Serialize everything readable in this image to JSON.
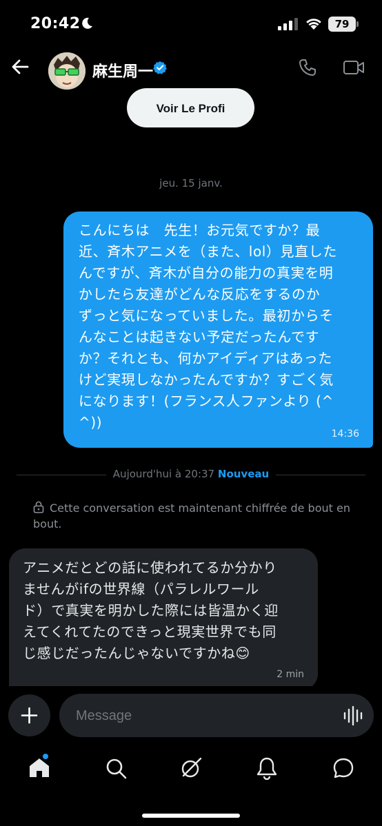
{
  "status_bar": {
    "time": "20:42",
    "battery": "79"
  },
  "header": {
    "contact_name": "麻生周一",
    "back_icon": "arrow-left-icon",
    "call_icon": "phone-icon",
    "video_icon": "video-camera-icon"
  },
  "profile_button": {
    "label": "Voir Le Profi"
  },
  "thread": {
    "date_separator": "jeu. 15 janv.",
    "outgoing": {
      "lines": [
        "こんにちは　先生！お元気ですか？最",
        "近、斉木アニメを（また、lol）見直した",
        "んですが、斉木が自分の能力の真実を明",
        "かしたら友達がどんな反応をするのか",
        "ずっと気になっていました。最初からそ",
        "んなことは起きない予定だったんです",
        "か？それとも、何かアイディアはあった",
        "けど実現しなかったんですか？すごく気",
        "になります！(フランス人ファンより (^",
        "^))"
      ],
      "time": "14:36"
    },
    "new_separator": {
      "text": "Aujourd'hui à 20:37",
      "badge": "Nouveau"
    },
    "encryption_notice": "Cette conversation est maintenant chiffrée de bout en bout.",
    "incoming": {
      "lines": [
        "アニメだとどの話に使われてるか分かり",
        "ませんがifの世界線（パラレルワール",
        "ド）で真実を明かした際には皆温かく迎",
        "えてくれてたのできっと現実世界でも同",
        "じ感じだったんじゃないですかね😊"
      ],
      "time": "2 min"
    }
  },
  "composer": {
    "placeholder": "Message",
    "add_icon": "plus-icon",
    "voice_icon": "voice-waveform-icon"
  },
  "tabbar": {
    "items": [
      "home-icon",
      "search-icon",
      "grok-icon",
      "notifications-icon",
      "messages-icon"
    ]
  },
  "colors": {
    "accent": "#1d9bf0",
    "background": "#000000",
    "incoming_bubble": "#202327"
  }
}
